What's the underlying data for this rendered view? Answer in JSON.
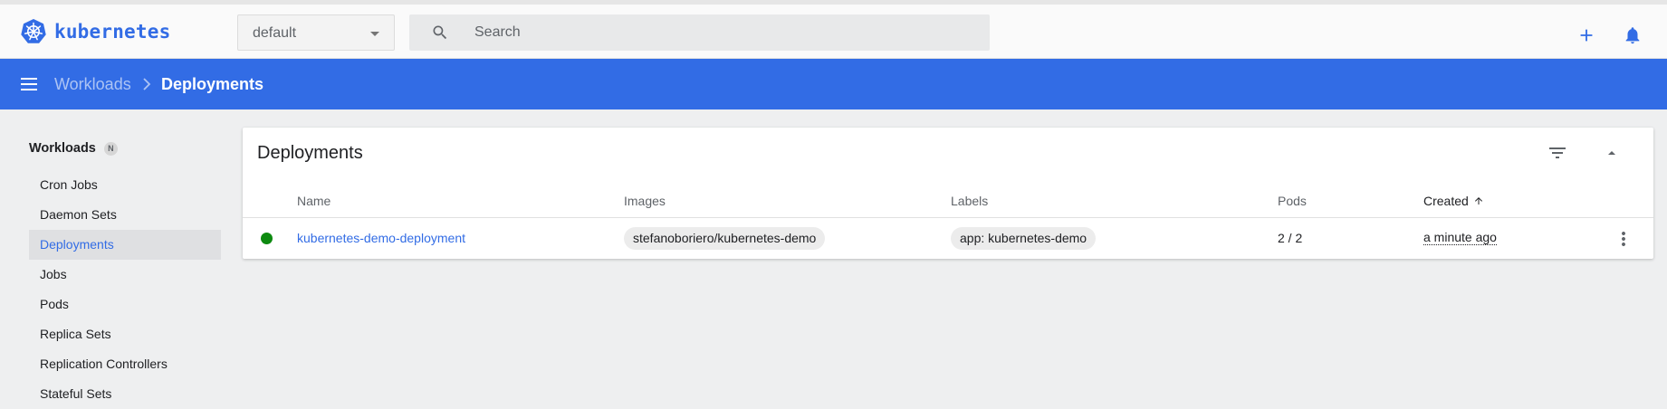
{
  "app": {
    "name": "kubernetes",
    "brand_color": "#326ce5"
  },
  "topbar": {
    "namespace": {
      "value": "default"
    },
    "search": {
      "placeholder": "Search"
    },
    "icons": [
      "add-icon",
      "notifications-icon"
    ]
  },
  "breadcrumb": {
    "parent": "Workloads",
    "current": "Deployments"
  },
  "sidebar": {
    "section": {
      "label": "Workloads",
      "badge": "N"
    },
    "items": [
      {
        "label": "Cron Jobs",
        "active": false
      },
      {
        "label": "Daemon Sets",
        "active": false
      },
      {
        "label": "Deployments",
        "active": true
      },
      {
        "label": "Jobs",
        "active": false
      },
      {
        "label": "Pods",
        "active": false
      },
      {
        "label": "Replica Sets",
        "active": false
      },
      {
        "label": "Replication Controllers",
        "active": false
      },
      {
        "label": "Stateful Sets",
        "active": false
      }
    ]
  },
  "deployments_card": {
    "title": "Deployments",
    "columns": {
      "name": "Name",
      "images": "Images",
      "labels": "Labels",
      "pods": "Pods",
      "created": "Created"
    },
    "rows": [
      {
        "status": "running",
        "status_color": "#0d8a10",
        "name": "kubernetes-demo-deployment",
        "image": "stefanoboriero/kubernetes-demo",
        "label": "app: kubernetes-demo",
        "pods": "2 / 2",
        "created": "a minute ago"
      }
    ]
  }
}
